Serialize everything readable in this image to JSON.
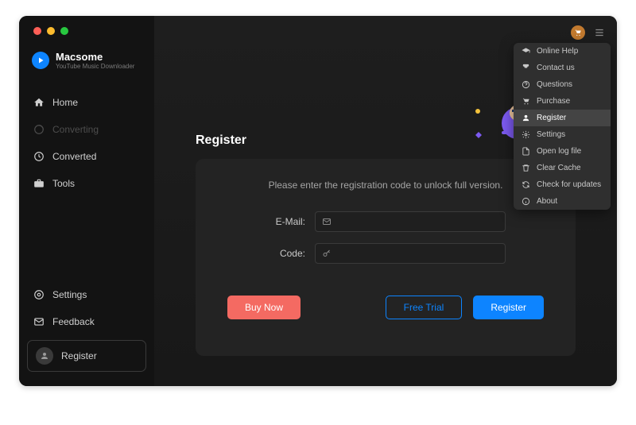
{
  "app": {
    "brand": "Macsome",
    "subtitle": "YouTube Music Downloader"
  },
  "sidebar": {
    "items": [
      {
        "label": "Home",
        "icon": "home"
      },
      {
        "label": "Converting",
        "icon": "progress",
        "dim": true
      },
      {
        "label": "Converted",
        "icon": "clock"
      },
      {
        "label": "Tools",
        "icon": "briefcase"
      }
    ],
    "bottom": [
      {
        "label": "Settings",
        "icon": "gear"
      },
      {
        "label": "Feedback",
        "icon": "mail"
      }
    ],
    "register_label": "Register"
  },
  "page": {
    "title": "Register",
    "instruction": "Please enter the registration code to unlock full version.",
    "email_label": "E-Mail:",
    "code_label": "Code:",
    "buttons": {
      "buy": "Buy Now",
      "trial": "Free Trial",
      "register": "Register"
    }
  },
  "menu": {
    "items": [
      {
        "label": "Online Help",
        "icon": "cap"
      },
      {
        "label": "Contact us",
        "icon": "phone"
      },
      {
        "label": "Questions",
        "icon": "question"
      },
      {
        "label": "Purchase",
        "icon": "cart"
      },
      {
        "label": "Register",
        "icon": "user",
        "highlight": true
      },
      {
        "label": "Settings",
        "icon": "gear"
      },
      {
        "label": "Open log file",
        "icon": "file"
      },
      {
        "label": "Clear Cache",
        "icon": "trash"
      },
      {
        "label": "Check for updates",
        "icon": "refresh"
      },
      {
        "label": "About",
        "icon": "info"
      }
    ]
  },
  "colors": {
    "accent": "#0d84ff",
    "buy": "#f46a62"
  }
}
